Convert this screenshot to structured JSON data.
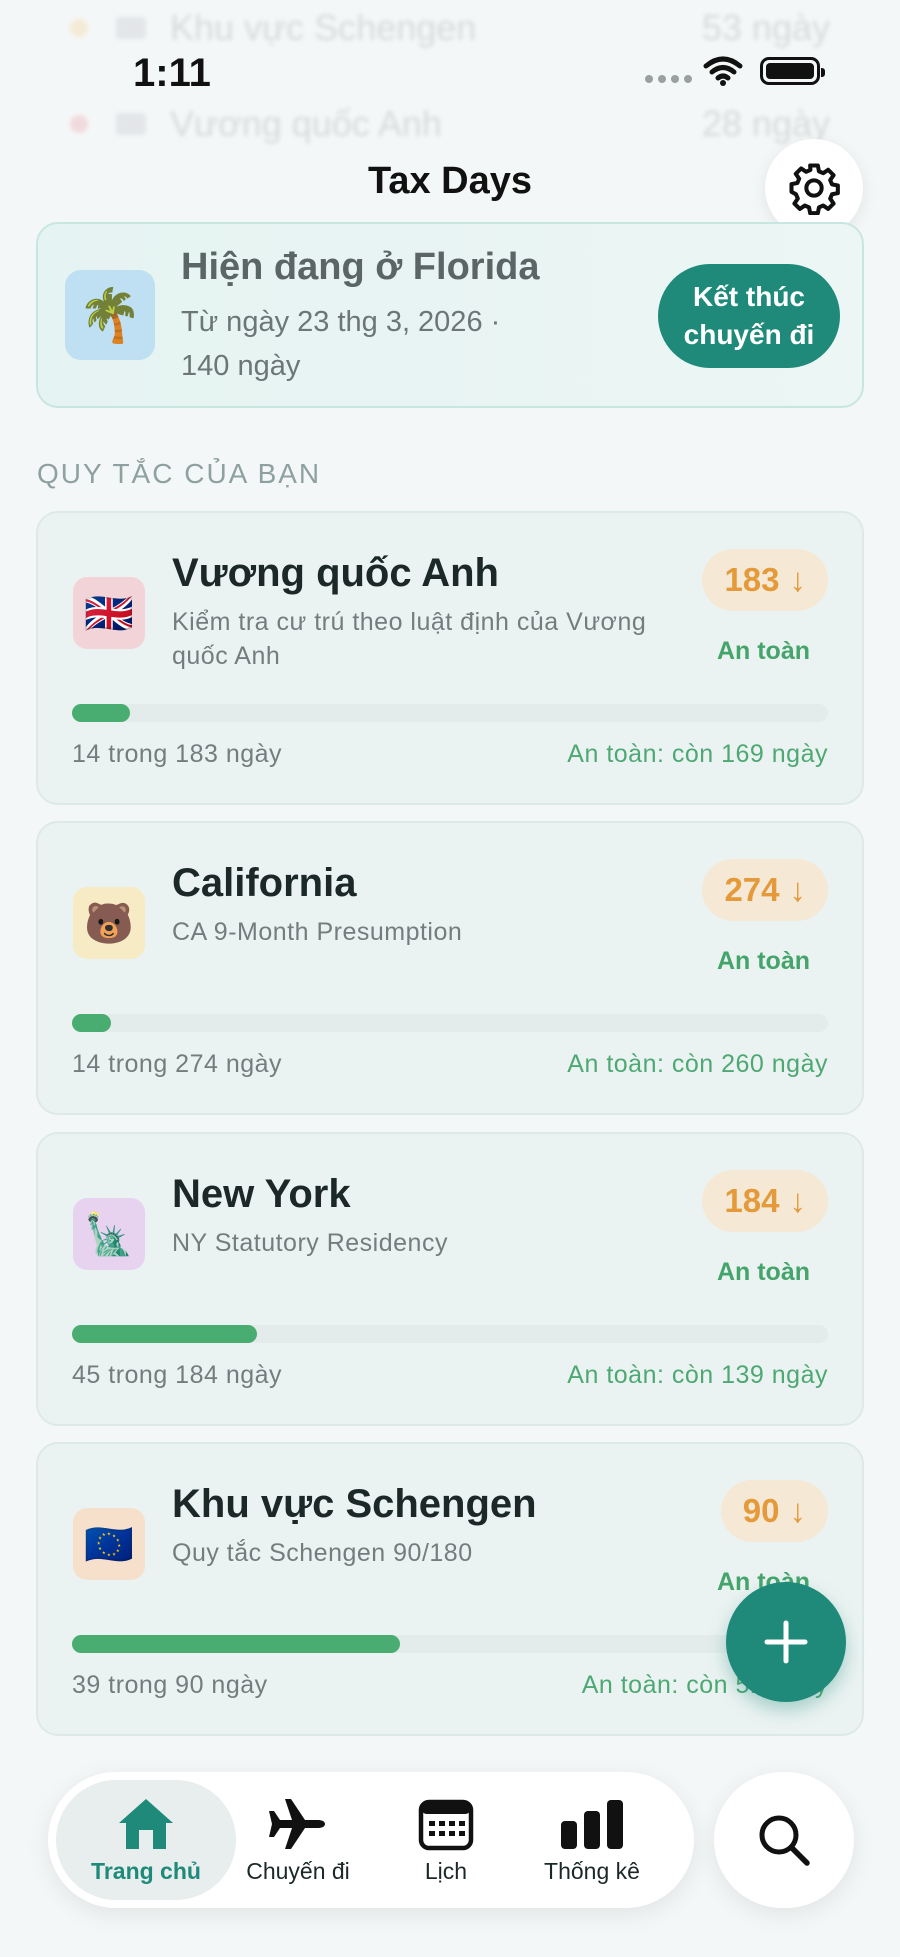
{
  "background_rows": [
    {
      "name": "Khu vực Schengen",
      "days": "53 ngày",
      "color": "#f5b342"
    },
    {
      "name": "Vương quốc Anh",
      "days": "28 ngày",
      "color": "#e85a6a"
    }
  ],
  "status_bar": {
    "time": "1:11"
  },
  "header": {
    "title": "Tax Days"
  },
  "current_trip": {
    "icon": "palm-tree",
    "title": "Hiện đang ở Florida",
    "subtitle": "Từ ngày 23 thg 3, 2026 · 140 ngày",
    "end_button": "Kết thúc chuyến đi"
  },
  "rules_section": {
    "heading": "QUY TẮC CỦA BẠN"
  },
  "rules": [
    {
      "icon": "🇬🇧",
      "icon_bg": "#f2d4d8",
      "name": "Vương quốc Anh",
      "description": "Kiểm tra cư trú theo luật định của Vương quốc Anh",
      "limit": "183",
      "status": "An toàn",
      "used_text": "14 trong 183 ngày",
      "remaining_text": "An toàn: còn 169 ngày",
      "progress": 0.0765
    },
    {
      "icon": "🐻",
      "icon_bg": "#f6ebc4",
      "name": "California",
      "description": "CA 9-Month Presumption",
      "limit": "274",
      "status": "An toàn",
      "used_text": "14 trong 274 ngày",
      "remaining_text": "An toàn: còn 260 ngày",
      "progress": 0.0511
    },
    {
      "icon": "🗽",
      "icon_bg": "#e7d3ef",
      "name": "New York",
      "description": "NY Statutory Residency",
      "limit": "184",
      "status": "An toàn",
      "used_text": "45 trong 184 ngày",
      "remaining_text": "An toàn: còn 139 ngày",
      "progress": 0.2446
    },
    {
      "icon": "🇪🇺",
      "icon_bg": "#f6e0cc",
      "name": "Khu vực Schengen",
      "description": "Quy tắc Schengen 90/180",
      "limit": "90",
      "status": "An toàn",
      "used_text": "39 trong 90 ngày",
      "remaining_text": "An toàn: còn 51 ngày",
      "progress": 0.4333
    }
  ],
  "tabs": [
    {
      "label": "Trang chủ",
      "icon": "house-icon",
      "active": true
    },
    {
      "label": "Chuyến đi",
      "icon": "airplane-icon",
      "active": false
    },
    {
      "label": "Lịch",
      "icon": "calendar-icon",
      "active": false
    },
    {
      "label": "Thống kê",
      "icon": "bar-chart-icon",
      "active": false
    }
  ],
  "colors": {
    "accent": "#1f8a79",
    "safe": "#49ad71",
    "badge_text": "#e49a3a",
    "badge_bg": "#f5e8d4"
  }
}
